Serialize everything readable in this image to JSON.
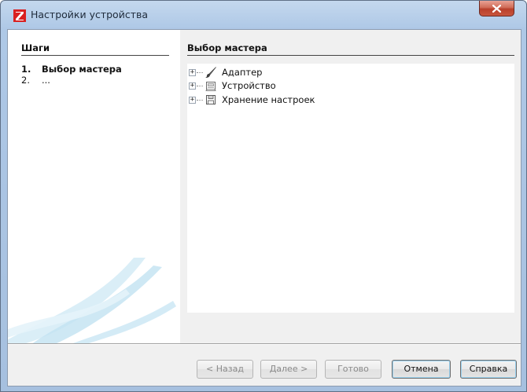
{
  "window": {
    "title": "Настройки устройства",
    "close_symbol": "x"
  },
  "steps_panel": {
    "heading": "Шаги",
    "items": [
      {
        "number": "1.",
        "label": "Выбор мастера",
        "current": true
      },
      {
        "number": "2.",
        "label": "...",
        "current": false
      }
    ]
  },
  "main_panel": {
    "heading": "Выбор мастера",
    "tree": [
      {
        "label": "Адаптер",
        "icon": "brush-icon",
        "expander": "+"
      },
      {
        "label": "Устройство",
        "icon": "device-icon",
        "expander": "+"
      },
      {
        "label": "Хранение настроек",
        "icon": "floppy-disk-icon",
        "expander": "+"
      }
    ]
  },
  "buttons": {
    "back": "< Назад",
    "next": "Далее >",
    "finish": "Готово",
    "cancel": "Отмена",
    "help": "Справка"
  },
  "colors": {
    "titlebar": "#aec8e6",
    "close_button": "#c9553d",
    "app_icon": "#d92020",
    "default_button_glow": "#9ad1ef"
  }
}
